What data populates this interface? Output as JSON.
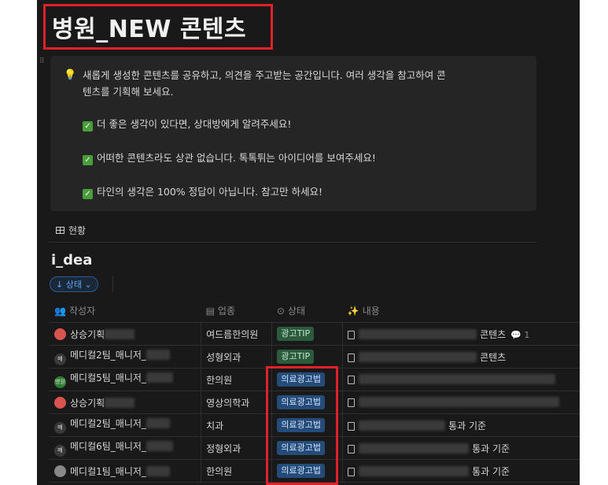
{
  "page": {
    "title": "병원_NEW 콘텐츠"
  },
  "callout": {
    "icon": "lightbulb-icon",
    "intro_line1": "새롭게 생성한 콘텐츠를 공유하고, 의견을 주고받는 공간입니다. 여러 생각을 참고하여 콘",
    "intro_line2": "텐츠를 기획해 보세요.",
    "items": [
      "더 좋은 생각이 있다면, 상대방에게 알려주세요!",
      "어떠한 콘텐츠라도 상관 없습니다. 톡톡튀는 아이디어를 보여주세요!",
      "타인의 생각은 100% 정답이 아닙니다. 참고만 하세요!"
    ]
  },
  "view": {
    "tab_label": "현황"
  },
  "database": {
    "title": "i_dea",
    "filter_label": "↓ 상태 ⌄",
    "columns": {
      "author": "작성자",
      "category": "업종",
      "status": "상태",
      "content": "내용"
    },
    "rows": [
      {
        "author": "상승기획",
        "avatar": "",
        "category": "여드름한의원",
        "status": "광고TIP",
        "status_type": "tip",
        "content_suffix": "콘텐츠",
        "comment_count": "1"
      },
      {
        "author": "메디컬2팀_매니저_",
        "avatar": "메",
        "category": "성형외과",
        "status": "광고TIP",
        "status_type": "tip",
        "content_suffix": "콘텐츠",
        "comment_count": ""
      },
      {
        "author": "메디컬5팀_매니저_",
        "avatar": "병원",
        "category": "한의원",
        "status": "의료광고법",
        "status_type": "law",
        "content_suffix": "",
        "comment_count": ""
      },
      {
        "author": "상승기획",
        "avatar": "",
        "category": "영상의학과",
        "status": "의료광고법",
        "status_type": "law",
        "content_suffix": "",
        "comment_count": ""
      },
      {
        "author": "메디컬2팀_매니저_",
        "avatar": "메",
        "category": "치과",
        "status": "의료광고법",
        "status_type": "law",
        "content_suffix": "통과 기준",
        "comment_count": ""
      },
      {
        "author": "메디컬6팀_매니저_",
        "avatar": "메",
        "category": "정형외과",
        "status": "의료광고법",
        "status_type": "law",
        "content_suffix": "통과 기준",
        "comment_count": ""
      },
      {
        "author": "메디컬1팀_매니저_",
        "avatar": "",
        "category": "한의원",
        "status": "의료광고법",
        "status_type": "law",
        "content_suffix": "통과 기준",
        "comment_count": ""
      }
    ]
  },
  "colors": {
    "background": "#191919",
    "callout_bg": "#252525",
    "highlight_border": "#e0212a",
    "tag_tip": "#2c5a3d",
    "tag_law": "#254b78",
    "filter_accent": "#5aa4f0"
  }
}
